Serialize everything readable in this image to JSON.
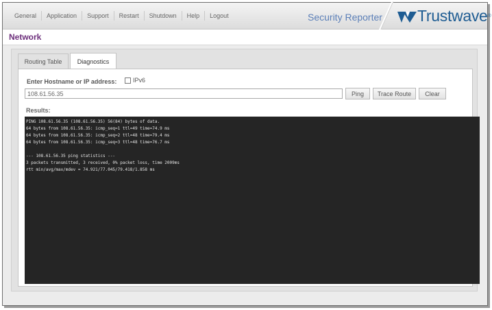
{
  "nav": {
    "items": [
      "General",
      "Application",
      "Support",
      "Restart",
      "Shutdown",
      "Help",
      "Logout"
    ]
  },
  "brand": {
    "product": "Security Reporter",
    "logo_text": "Trustwave",
    "logo_mark": "®",
    "logo_color": "#1f5d93",
    "accent_color": "#5b7fb8"
  },
  "page": {
    "title": "Network",
    "title_color": "#6b2d7a"
  },
  "tabs": {
    "routing": "Routing Table",
    "diagnostics": "Diagnostics",
    "active": "Diagnostics"
  },
  "form": {
    "host_label": "Enter Hostname or IP address:",
    "ipv6_label": "IPv6",
    "ipv6_checked": false,
    "host_value": "108.61.56.35",
    "ping_label": "Ping",
    "trace_label": "Trace Route",
    "clear_label": "Clear"
  },
  "results": {
    "label": "Results:",
    "lines": [
      "PING 108.61.56.35 (108.61.56.35) 56(84) bytes of data.",
      "64 bytes from 108.61.56.35: icmp_seq=1 ttl=49 time=74.9 ms",
      "64 bytes from 108.61.56.35: icmp_seq=2 ttl=48 time=79.4 ms",
      "64 bytes from 108.61.56.35: icmp_seq=3 ttl=48 time=76.7 ms",
      "",
      "--- 108.61.56.35 ping statistics ---",
      "3 packets transmitted, 3 received, 0% packet loss, time 2009ms",
      "rtt min/avg/max/mdev = 74.921/77.045/79.418/1.858 ms"
    ]
  }
}
